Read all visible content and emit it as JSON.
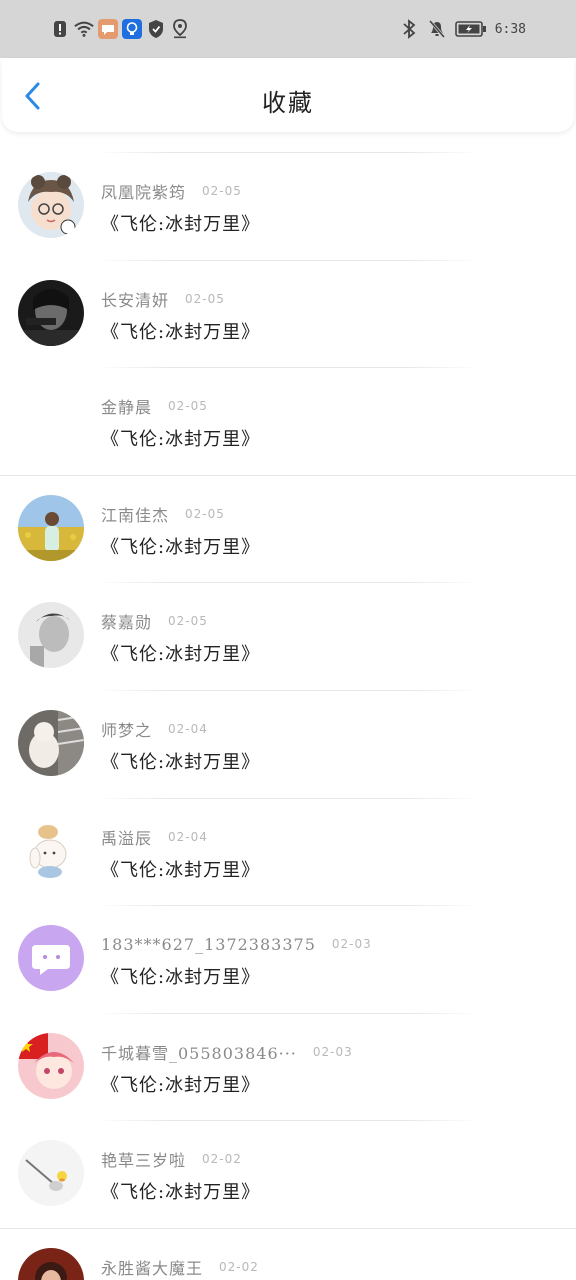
{
  "status_bar": {
    "time": "6:38",
    "icons": [
      "alert-icon",
      "wifi-icon",
      "message-icon",
      "bulb-icon",
      "shield-icon",
      "location-icon",
      "bluetooth-icon",
      "mute-icon",
      "battery-icon"
    ]
  },
  "header": {
    "title": "收藏",
    "back_icon": "chevron-left-icon"
  },
  "colors": {
    "accent": "#2b8ae6",
    "status_bar_bg": "#d6d6d6"
  },
  "items": [
    {
      "name": "凤凰院紫筠",
      "date": "02-05",
      "content": "《飞伦:冰封万里》",
      "avatar": "cartoon-girl-avatar"
    },
    {
      "name": "长安清妍",
      "date": "02-05",
      "content": "《飞伦:冰封万里》",
      "avatar": "dark-photo-avatar"
    },
    {
      "name": "金静晨",
      "date": "02-05",
      "content": "《飞伦:冰封万里》",
      "avatar": ""
    },
    {
      "name": "江南佳杰",
      "date": "02-05",
      "content": "《飞伦:冰封万里》",
      "avatar": "field-photo-avatar"
    },
    {
      "name": "蔡嘉勋",
      "date": "02-05",
      "content": "《飞伦:冰封万里》",
      "avatar": "bw-portrait-avatar"
    },
    {
      "name": "师梦之",
      "date": "02-04",
      "content": "《飞伦:冰封万里》",
      "avatar": "cat-photo-avatar"
    },
    {
      "name": "禹溢辰",
      "date": "02-04",
      "content": "《飞伦:冰封万里》",
      "avatar": "bunny-avatar"
    },
    {
      "name": "183***627_1372383375",
      "date": "02-03",
      "content": "《飞伦:冰封万里》",
      "avatar": "chat-bubble-avatar"
    },
    {
      "name": "千城暮雪_055803846···",
      "date": "02-03",
      "content": "《飞伦:冰封万里》",
      "avatar": "anime-flag-avatar"
    },
    {
      "name": "艳草三岁啦",
      "date": "02-02",
      "content": "《飞伦:冰封万里》",
      "avatar": "cartoon-sketch-avatar"
    },
    {
      "name": "永胜酱大魔王",
      "date": "02-02",
      "content": "",
      "avatar": "red-portrait-avatar"
    }
  ]
}
